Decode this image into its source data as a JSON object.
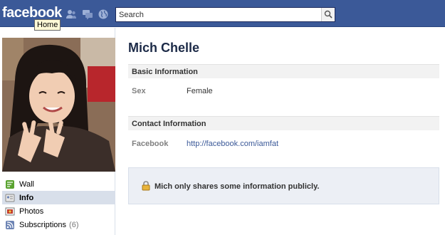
{
  "topbar": {
    "logo": "facebook",
    "tooltip": "Home",
    "search_placeholder": "Search",
    "colors": {
      "bar": "#3b5998"
    },
    "icons": [
      "friend-requests-icon",
      "messages-icon",
      "notifications-globe-icon",
      "search-icon"
    ]
  },
  "profile": {
    "name": "Mich Chelle"
  },
  "nav": {
    "items": [
      {
        "label": "Wall",
        "icon": "wall-icon"
      },
      {
        "label": "Info",
        "icon": "info-icon"
      },
      {
        "label": "Photos",
        "icon": "photos-icon"
      },
      {
        "label": "Subscriptions",
        "icon": "subscriptions-icon",
        "count": "(6)"
      }
    ],
    "selected": "Info"
  },
  "basic": {
    "heading": "Basic Information",
    "sex_label": "Sex",
    "sex_value": "Female"
  },
  "contact": {
    "heading": "Contact Information",
    "facebook_label": "Facebook",
    "facebook_value": "http://facebook.com/iamfat"
  },
  "notice": {
    "text": "Mich only shares some information publicly.",
    "icon": "lock-icon"
  }
}
